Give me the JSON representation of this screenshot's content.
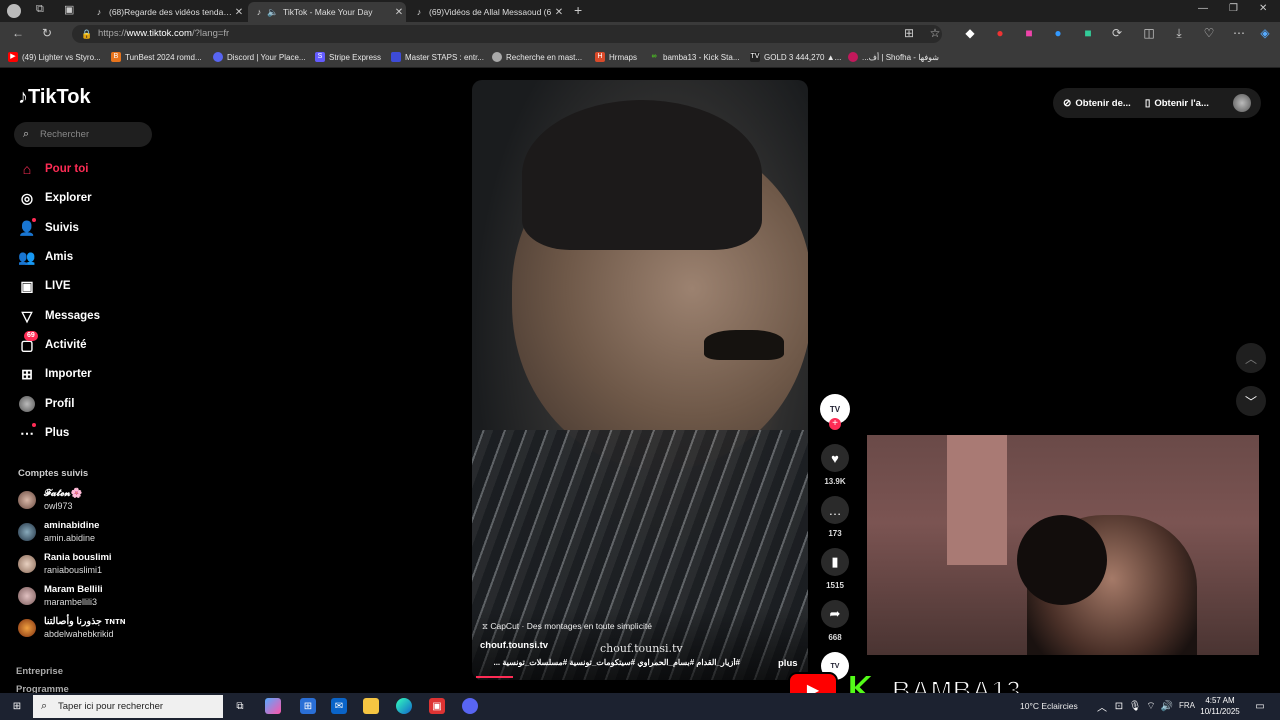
{
  "browser": {
    "tabs": [
      {
        "title": "(68)Regarde des vidéos tendanc",
        "active": false
      },
      {
        "title": "TikTok - Make Your Day",
        "active": true
      },
      {
        "title": "(69)Vidéos de Allal Messaoud (6",
        "active": false
      }
    ],
    "url_prefix": "https://",
    "url_host": "www.tiktok.com",
    "url_path": "/?lang=fr",
    "bookmarks": [
      {
        "label": "(49) Lighter vs Styro...",
        "color": "#ff0000"
      },
      {
        "label": "TunBest 2024 romd...",
        "color": "#e8741c"
      },
      {
        "label": "Discord | Your Place...",
        "color": "#5865f2"
      },
      {
        "label": "Stripe Express",
        "color": "#635bff"
      },
      {
        "label": "Master STAPS : entr...",
        "color": "#3d4bd8"
      },
      {
        "label": "Recherche en mast...",
        "color": "#aaaaaa"
      },
      {
        "label": "Hrmaps",
        "color": "#d94a2a"
      },
      {
        "label": "bamba13 - Kick Sta...",
        "color": "#53fc18"
      },
      {
        "label": "GOLD 3 444,270 ▲...",
        "color": "#222222"
      },
      {
        "label": "...أف | Shofha - شوفها",
        "color": "#c2185b"
      }
    ]
  },
  "sidebar": {
    "logo": "TikTok",
    "search_placeholder": "Rechercher",
    "nav": [
      {
        "label": "Pour toi",
        "icon": "home-icon"
      },
      {
        "label": "Explorer",
        "icon": "compass-icon"
      },
      {
        "label": "Suivis",
        "icon": "user-follow-icon"
      },
      {
        "label": "Amis",
        "icon": "friends-icon"
      },
      {
        "label": "LIVE",
        "icon": "live-icon"
      },
      {
        "label": "Messages",
        "icon": "send-icon"
      },
      {
        "label": "Activité",
        "icon": "inbox-icon",
        "badge": "69"
      },
      {
        "label": "Importer",
        "icon": "upload-icon"
      },
      {
        "label": "Profil",
        "icon": "profile-icon"
      },
      {
        "label": "Plus",
        "icon": "more-icon"
      }
    ],
    "following_title": "Comptes suivis",
    "following": [
      {
        "name": "𝓕𝓪𝓽𝓮𝓷🌸",
        "user": "owl973"
      },
      {
        "name": "aminabidine",
        "user": "amin.abidine"
      },
      {
        "name": "Rania bouslimi",
        "user": "raniabouslimi1"
      },
      {
        "name": "Maram Bellili",
        "user": "marambellili3"
      },
      {
        "name": "جذورنا وأصالتنا ᴛɴᴛɴ",
        "user": "abdelwahebkrikid"
      }
    ],
    "footer": [
      "Entreprise",
      "Programme"
    ]
  },
  "video": {
    "capcut": "CapCut · Des montages en toute simplicité",
    "username": "chouf.tounsi.tv",
    "watermark": "chouf.tounsi.tv",
    "hashtags": "#أزيار_القدام #بسام_الحمراوي #سيتكومات_تونسية #مسلسلات_تونسية ...",
    "more": "plus",
    "progress": 0.11,
    "actions": {
      "likes": "13.9K",
      "comments": "173",
      "saves": "1515",
      "shares": "668"
    }
  },
  "topright": {
    "get_desktop": "Obtenir de...",
    "get_app": "Obtenir l'a..."
  },
  "stream": {
    "brand_name": "BAMBA13"
  },
  "taskbar": {
    "search_placeholder": "Taper ici pour rechercher",
    "weather": "10°C  Eclaircies",
    "lang": "FRA",
    "time": "4:57 AM",
    "date": "10/11/2025"
  }
}
